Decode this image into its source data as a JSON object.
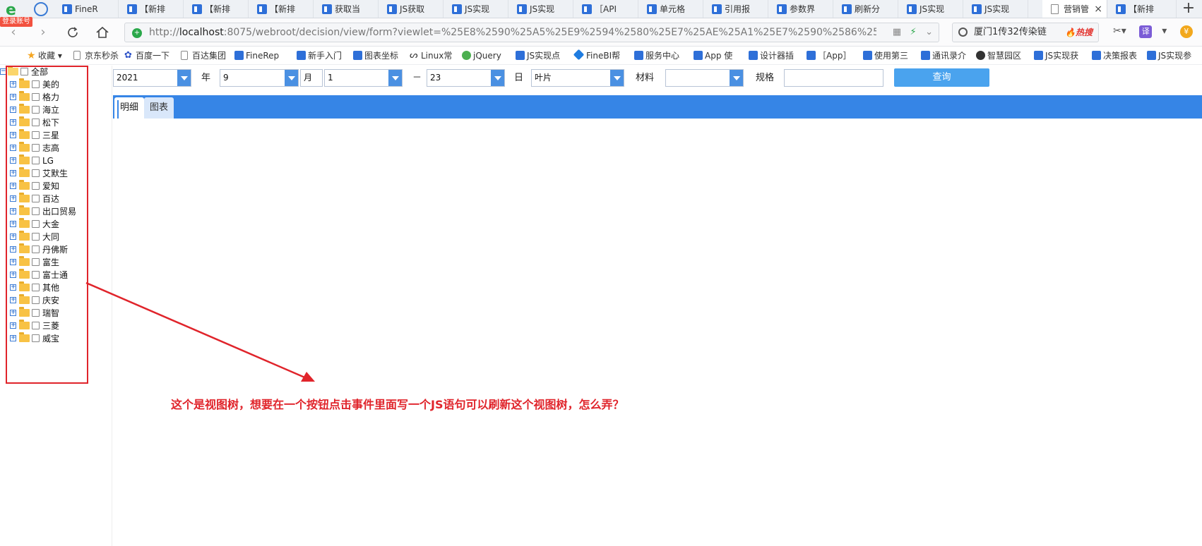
{
  "browser": {
    "login_badge": "登录账号",
    "tabs": [
      {
        "label": "FineR"
      },
      {
        "label": "【新排"
      },
      {
        "label": "【新排"
      },
      {
        "label": "【新排"
      },
      {
        "label": "获取当"
      },
      {
        "label": "JS获取"
      },
      {
        "label": "JS实现"
      },
      {
        "label": "JS实现"
      },
      {
        "label": "［API"
      },
      {
        "label": "单元格"
      },
      {
        "label": "引用报"
      },
      {
        "label": "参数界"
      },
      {
        "label": "刷新分"
      },
      {
        "label": "JS实现"
      },
      {
        "label": "JS实现"
      },
      {
        "label": "营销管"
      },
      {
        "label": "【新排"
      }
    ],
    "active_tab_close": "×",
    "new_tab": "+",
    "address": {
      "scheme": "http://",
      "host": "localhost",
      "rest": ":8075/webroot/decision/view/form?viewlet=%25E8%2590%25A5%25E9%2594%2580%25E7%25AE%25A1%25E7%2590%2586%25E6%258A%"
    },
    "search": {
      "text": "厦门1传32传染链",
      "hot": "🔥热搜"
    },
    "tool_translate": "译",
    "tool_coin": "¥",
    "bookmarks": [
      {
        "label": "收藏"
      },
      {
        "label": "京东秒杀"
      },
      {
        "label": "百度一下"
      },
      {
        "label": "百达集团"
      },
      {
        "label": "FineRep"
      },
      {
        "label": "新手入门"
      },
      {
        "label": "图表坐标"
      },
      {
        "label": "Linux常"
      },
      {
        "label": "jQuery"
      },
      {
        "label": "JS实现点"
      },
      {
        "label": "FineBI帮"
      },
      {
        "label": "服务中心"
      },
      {
        "label": "App 使"
      },
      {
        "label": "设计器插"
      },
      {
        "label": "［App］"
      },
      {
        "label": "使用第三"
      },
      {
        "label": "通讯录介"
      },
      {
        "label": "智慧园区"
      },
      {
        "label": "JS实现获"
      },
      {
        "label": "决策报表"
      },
      {
        "label": "JS实现参"
      }
    ]
  },
  "tree": {
    "root": "全部",
    "items": [
      "美的",
      "格力",
      "海立",
      "松下",
      "三星",
      "志高",
      "LG",
      "艾默生",
      "爱知",
      "百达",
      "出口贸易",
      "大金",
      "大同",
      "丹佛斯",
      "富生",
      "富士通",
      "其他",
      "庆安",
      "瑞智",
      "三菱",
      "威宝"
    ]
  },
  "form": {
    "year_value": "2021",
    "year_label": "年",
    "month_value": "9",
    "month_label": "月",
    "day_from": "1",
    "range_sep": "－",
    "day_to": "23",
    "day_label": "日",
    "material_type": "叶片",
    "material_label": "材料",
    "material_value": "",
    "spec_label": "规格",
    "spec_value": "",
    "query": "查询"
  },
  "content_tabs": [
    {
      "label": "明细"
    },
    {
      "label": "图表"
    }
  ],
  "annotation": "这个是视图树，想要在一个按钮点击事件里面写一个JS语句可以刷新这个视图树，怎么弄？",
  "colors": {
    "accent": "#3685e6",
    "button": "#4aa3ee",
    "annotation_red": "#e0242b"
  }
}
